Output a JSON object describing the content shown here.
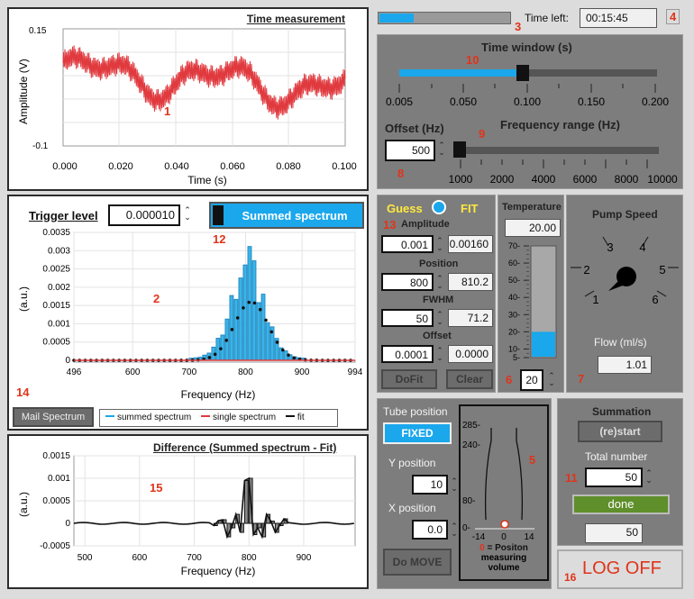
{
  "time_panel": {
    "title": "Time measurement",
    "ylabel": "Amplitude (V)",
    "xlabel": "Time (s)",
    "y_ticks": [
      "0.15",
      "-0.1"
    ],
    "x_ticks": [
      "0.000",
      "0.020",
      "0.040",
      "0.060",
      "0.080",
      "0.100"
    ],
    "marker": "1"
  },
  "trigger": {
    "label": "Trigger level",
    "value": "0.000010",
    "summed_btn": "Summed spectrum",
    "marker": "12"
  },
  "spectrum_panel": {
    "ylabel": "(a.u.)",
    "xlabel": "Frequency (Hz)",
    "y_ticks": [
      "0.0035",
      "0.003",
      "0.0025",
      "0.002",
      "0.0015",
      "0.001",
      "0.0005",
      "0"
    ],
    "x_ticks": [
      "496",
      "600",
      "700",
      "800",
      "900",
      "994"
    ],
    "marker": "2",
    "mail_btn": "Mail Spectrum",
    "marker14": "14",
    "legend": [
      "summed spectrum",
      "single spectrum",
      "fit"
    ]
  },
  "diff_panel": {
    "title": "Difference  (Summed spectrum - Fit)",
    "ylabel": "(a.u.)",
    "xlabel": "Frequency (Hz)",
    "y_ticks": [
      "0.0015",
      "0.001",
      "0.0005",
      "0",
      "-0.0005"
    ],
    "x_ticks": [
      "500",
      "600",
      "700",
      "800",
      "900"
    ],
    "marker": "15"
  },
  "top": {
    "progress": 0.26,
    "marker3": "3",
    "time_left_label": "Time left:",
    "time_left": "00:15:45",
    "marker4": "4"
  },
  "time_window": {
    "title": "Time window (s)",
    "marker": "10",
    "value": 0.1,
    "ticks": [
      "0.005",
      "0.050",
      "0.100",
      "0.150",
      "0.200"
    ]
  },
  "freq_range": {
    "offset_label": "Offset (Hz)",
    "offset_value": "500",
    "marker9": "9",
    "title": "Frequency range (Hz)",
    "marker8": "8",
    "ticks": [
      "1000",
      "2000",
      "4000",
      "6000",
      "8000",
      "10000"
    ]
  },
  "fit_panel": {
    "guess": "Guess",
    "fit": "FIT",
    "marker": "13",
    "amplitude_label": "Amplitude",
    "amplitude_guess": "0.001",
    "amplitude_fit": "0.00160",
    "position_label": "Position",
    "position_guess": "800",
    "position_fit": "810.2",
    "fwhm_label": "FWHM",
    "fwhm_guess": "50",
    "fwhm_fit": "71.2",
    "offset_label": "Offset",
    "offset_guess": "0.0001",
    "offset_fit": "0.0000",
    "dofit": "DoFit",
    "clear": "Clear"
  },
  "temperature": {
    "title": "Temperature",
    "value": "20.00",
    "set_value": "20",
    "marker": "6",
    "ticks": [
      "70",
      "60",
      "50",
      "40",
      "30",
      "20",
      "10",
      "5"
    ],
    "level": 20
  },
  "pump": {
    "title": "Pump Speed",
    "dial": [
      "1",
      "2",
      "3",
      "4",
      "5",
      "6"
    ],
    "flow_label": "Flow (ml/s)",
    "flow_value": "1.01",
    "marker": "7"
  },
  "tube": {
    "title": "Tube position",
    "fixed_btn": "FIXED",
    "y_label": "Y position",
    "y_value": "10",
    "x_label": "X position",
    "x_value": "0.0",
    "move_btn": "Do MOVE",
    "marker": "5",
    "y_ticks": [
      "285-",
      "240-",
      "80-",
      "0-"
    ],
    "x_ticks": [
      "-14",
      "0",
      "14"
    ],
    "legend_num": "0",
    "legend": "= Positon",
    "legend2": "measuring",
    "legend3": "volume"
  },
  "summation": {
    "title": "Summation",
    "restart": "(re)start",
    "total_label": "Total number",
    "total_value": "50",
    "marker": "11",
    "done": "done",
    "count": "50"
  },
  "logoff": {
    "marker": "16",
    "label": "LOG OFF"
  },
  "colors": {
    "accent": "#1aa7ec",
    "bar": "#3ab4e8",
    "red_marker": "#e0341a",
    "done": "#5f8f2a"
  }
}
